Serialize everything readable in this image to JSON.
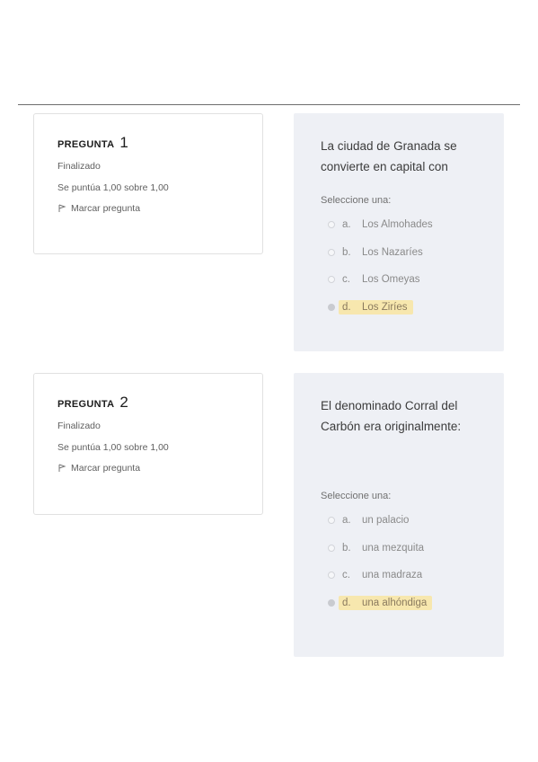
{
  "questions": [
    {
      "label": "PREGUNTA",
      "number": "1",
      "state": "Finalizado",
      "grade": "Se puntúa 1,00 sobre 1,00",
      "flag_label": "Marcar pregunta",
      "text": "La ciudad de Granada se convierte en capital con",
      "prompt": "Seleccione una:",
      "options": [
        {
          "letter": "a.",
          "text": "Los Almohades"
        },
        {
          "letter": "b.",
          "text": "Los Nazaríes"
        },
        {
          "letter": "c.",
          "text": "Los Omeyas"
        },
        {
          "letter": "d.",
          "text": "Los Ziríes"
        }
      ],
      "selected_index": 3
    },
    {
      "label": "PREGUNTA",
      "number": "2",
      "state": "Finalizado",
      "grade": "Se puntúa 1,00 sobre 1,00",
      "flag_label": "Marcar pregunta",
      "text": "El denominado Corral del Carbón era originalmente:",
      "prompt": "Seleccione una:",
      "options": [
        {
          "letter": "a.",
          "text": "un palacio"
        },
        {
          "letter": "b.",
          "text": "una mezquita"
        },
        {
          "letter": "c.",
          "text": "una madraza"
        },
        {
          "letter": "d.",
          "text": "una alhóndiga"
        }
      ],
      "selected_index": 3
    }
  ],
  "colors": {
    "content_bg": "#eef0f5",
    "selected_highlight": "#f7e7ae",
    "divider": "#6d6d6d"
  },
  "icons": {
    "flag": "flag-icon",
    "radio": "radio-button"
  }
}
